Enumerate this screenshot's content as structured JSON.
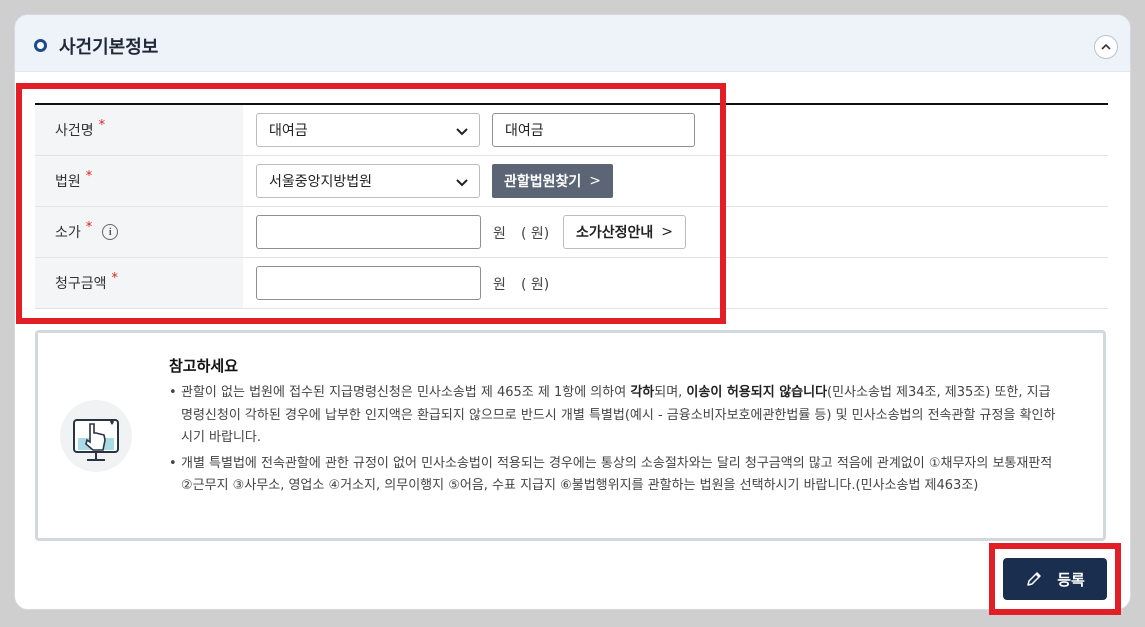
{
  "section": {
    "title": "사건기본정보"
  },
  "form": {
    "case_name": {
      "label": "사건명",
      "required_mark": "*",
      "select_value": "대여금",
      "input_value": "대여금"
    },
    "court": {
      "label": "법원",
      "required_mark": "*",
      "select_value": "서울중앙지방법원",
      "find_button": "관할법원찾기",
      "find_arrow": ">"
    },
    "claim_value": {
      "label": "소가",
      "required_mark": "*",
      "info_icon_glyph": "i",
      "value": "",
      "unit": "원",
      "unit_paren": "( 원)",
      "guide_button": "소가산정안내",
      "guide_arrow": ">"
    },
    "claim_amount": {
      "label": "청구금액",
      "required_mark": "*",
      "value": "",
      "unit": "원",
      "unit_paren": "( 원)"
    }
  },
  "notice": {
    "title": "참고하세요",
    "item1_a": "관할이 없는 법원에 접수된 지급명령신청은 민사소송법 제 465조 제 1항에 의하여 ",
    "item1_b": "각하",
    "item1_c": "되며, ",
    "item1_d": "이송이 허용되지 않습니다",
    "item1_e": "(민사소송법 제34조, 제35조) 또한, 지급명령신청이 각하된 경우에 납부한 인지액은 환급되지 않으므로 반드시 개별 특별법(예시 - 금융소비자보호에관한법률 등) 및 민사소송법의 전속관할 규정을 확인하시기 바랍니다.",
    "item2": "개별 특별법에 전속관할에 관한 규정이 없어 민사소송법이 적용되는 경우에는 통상의 소송절차와는 달리 청구금액의 많고 적음에 관계없이 ①채무자의 보통재판적 ②근무지 ③사무소, 영업소 ④거소지, 의무이행지 ⑤어음, 수표 지급지 ⑥불법행위지를 관할하는 법원을 선택하시기 바랍니다.(민사소송법 제463조)"
  },
  "actions": {
    "submit": "등록"
  },
  "icons": {
    "collapse": "chevron-up-icon",
    "select": "chevron-down-icon",
    "info": "info-icon",
    "submit": "pencil-icon",
    "illustration": "touch-screen-icon"
  },
  "colors": {
    "highlight": "#e21e26",
    "primary_button": "#1a2e4f",
    "secondary_button": "#5b6575",
    "header_bg": "#eef3fa"
  }
}
